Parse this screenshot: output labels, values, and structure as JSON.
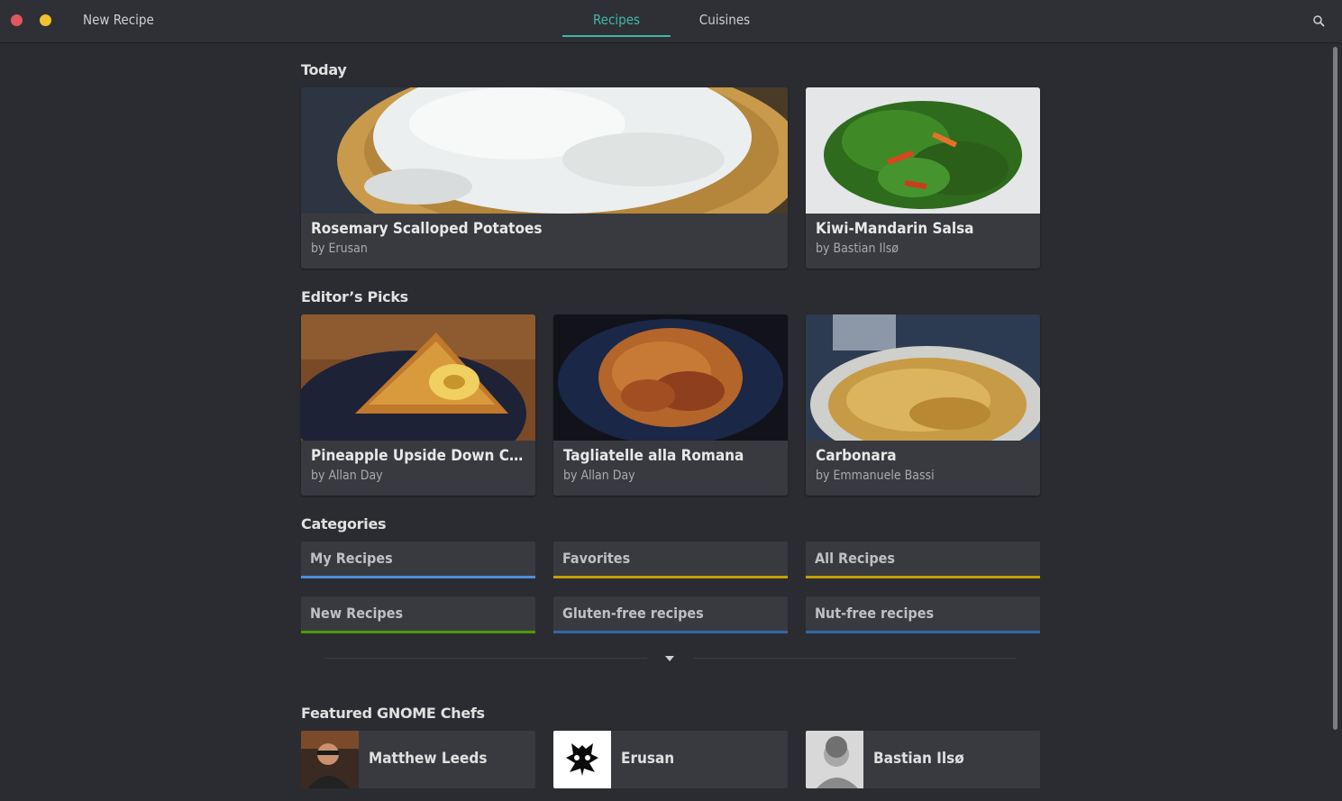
{
  "header": {
    "new_recipe": "New Recipe",
    "tabs": [
      {
        "label": "Recipes",
        "active": true
      },
      {
        "label": "Cuisines",
        "active": false
      }
    ]
  },
  "today": {
    "title": "Today",
    "cards": [
      {
        "title": "Rosemary Scalloped Potatoes",
        "author": "by Erusan"
      },
      {
        "title": "Kiwi-Mandarin Salsa",
        "author": "by Bastian Ilsø"
      }
    ]
  },
  "picks": {
    "title": "Editor’s Picks",
    "cards": [
      {
        "title": "Pineapple Upside Down Cake ...",
        "author": "by Allan Day"
      },
      {
        "title": "Tagliatelle alla Romana",
        "author": "by Allan Day"
      },
      {
        "title": "Carbonara",
        "author": "by Emmanuele Bassi"
      }
    ]
  },
  "categories": {
    "title": "Categories",
    "items": [
      {
        "label": "My Recipes",
        "color": "#4a90d9"
      },
      {
        "label": "Favorites",
        "color": "#c4a000"
      },
      {
        "label": "All Recipes",
        "color": "#c4a000"
      },
      {
        "label": "New Recipes",
        "color": "#4e9a06"
      },
      {
        "label": "Gluten-free recipes",
        "color": "#3465a4"
      },
      {
        "label": "Nut-free recipes",
        "color": "#3465a4"
      }
    ]
  },
  "chefs": {
    "title": "Featured GNOME Chefs",
    "items": [
      {
        "name": "Matthew Leeds"
      },
      {
        "name": "Erusan"
      },
      {
        "name": "Bastian Ilsø"
      }
    ]
  },
  "colors": {
    "accent": "#3fb9a2",
    "background": "#2b2c31",
    "card": "#393a40"
  },
  "icons": [
    "search-icon",
    "expand-arrow-icon"
  ]
}
